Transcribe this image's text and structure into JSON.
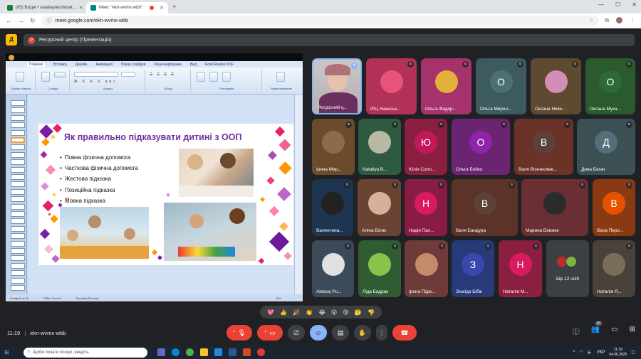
{
  "browser": {
    "tabs": [
      {
        "label": "(85) Вхідні • nataliayakuhonat...",
        "active": false,
        "fav_color": "#188038"
      },
      {
        "label": "Meet: \"ekn-wvmx-wbb\"",
        "active": true,
        "fav_color": "#00897b"
      }
    ],
    "url": "meet.google.com/ekn-wvmx-wbb"
  },
  "presentation_bar": {
    "label": "Ресурсний центр (Презентація)",
    "avatar_initial": "Р"
  },
  "ppt": {
    "tabs": [
      "Главная",
      "Вставка",
      "Дизайн",
      "Анимация",
      "Показ слайдов",
      "Рецензирование",
      "Вид",
      "Foxit Reader PDF"
    ],
    "ribbon_groups": [
      "Буфер обмена",
      "Слайды",
      "Шрифт",
      "Абзац",
      "Рисование",
      "Редактирование"
    ],
    "status": [
      "Слайд 6 из 28",
      "\"Office Theme\"",
      "Русский (Россия)",
      "40%"
    ],
    "slide": {
      "title": "Як правильно підказувати дитині з ООП",
      "bullets": [
        "Повна фізична допомога",
        "Часткова фізична допомога",
        "Жестова підказка",
        "Позиційна підказка",
        "Мовна підказка"
      ]
    }
  },
  "tiles": [
    {
      "name": "Ресурсний ц...",
      "type": "video",
      "color": "#c9c2c0"
    },
    {
      "name": "ІРЦ Уманськ...",
      "type": "pic",
      "color": "#b13157",
      "pic": "#e6547c"
    },
    {
      "name": "Ольга Федор...",
      "type": "pic",
      "color": "#a6326b",
      "pic": "#e3b03c"
    },
    {
      "name": "Ольга Мирон...",
      "type": "initial",
      "initial": "О",
      "color": "#3d5a5e",
      "circle": "#4e6f72"
    },
    {
      "name": "Оксана Ники...",
      "type": "pic",
      "color": "#5e4a30",
      "pic": "#d38db6"
    },
    {
      "name": "Оксана Муха...",
      "type": "initial",
      "initial": "О",
      "color": "#2b5a2f",
      "circle": "#2e6a33"
    },
    {
      "name": "Ірина Мир...",
      "type": "pic",
      "color": "#6a4c2c",
      "pic": "#8a6b4c"
    },
    {
      "name": "Nataliya B...",
      "type": "pic",
      "color": "#2e5a42",
      "pic": "#b7b9a3"
    },
    {
      "name": "Юлія Соло...",
      "type": "initial",
      "initial": "Ю",
      "color": "#8a1f3f",
      "circle": "#c2185b"
    },
    {
      "name": "Ольга Бойко",
      "type": "initial",
      "initial": "О",
      "color": "#6b2470",
      "circle": "#8e24aa"
    },
    {
      "name": "Валя Вознесиме...",
      "type": "initial",
      "initial": "В",
      "color": "#6b3228",
      "circle": "#5d4037"
    },
    {
      "name": "Дина Багач",
      "type": "initial",
      "initial": "Д",
      "color": "#3c5054",
      "circle": "#546e7a"
    },
    {
      "name": "Валентина...",
      "type": "pic",
      "color": "#1d3550",
      "pic": "#222"
    },
    {
      "name": "Аліна Білик",
      "type": "pic",
      "color": "#6b4332",
      "pic": "#d8b09a"
    },
    {
      "name": "Надія Пал...",
      "type": "initial",
      "initial": "Н",
      "color": "#891c45",
      "circle": "#d81b60"
    },
    {
      "name": "Валя Бандура",
      "type": "initial",
      "initial": "В",
      "color": "#5c3328",
      "circle": "#5d4037"
    },
    {
      "name": "Марина Бевзюк",
      "type": "pic",
      "color": "#6a2f32",
      "pic": "#2b2b2b"
    },
    {
      "name": "Вера Перо...",
      "type": "initial",
      "initial": "В",
      "color": "#8a3a12",
      "circle": "#e65100"
    },
    {
      "name": "Aleksej Pu...",
      "type": "pic",
      "color": "#3a4a58",
      "pic": "#e0e0e0"
    },
    {
      "name": "Ліда Бадрак",
      "type": "solid",
      "color": "#2f5c32",
      "circle": "#8bc34a"
    },
    {
      "name": "Ірина Підм...",
      "type": "pic",
      "color": "#6e3a3a",
      "pic": "#c58a6a"
    },
    {
      "name": "Зінаїда Бібік",
      "type": "initial",
      "initial": "З",
      "color": "#283a7a",
      "circle": "#3949ab"
    },
    {
      "name": "Наталія М...",
      "type": "initial",
      "initial": "Н",
      "color": "#8a1f3f",
      "circle": "#d81b60"
    },
    {
      "name": "Ще 12 осіб",
      "type": "more",
      "color": "#3c4043"
    },
    {
      "name": "Наталія Я...",
      "type": "pic",
      "color": "#48423a",
      "pic": "#7a6e5a"
    }
  ],
  "reactions": [
    "💖",
    "👍",
    "🎉",
    "👏",
    "😂",
    "😮",
    "😢",
    "🤔",
    "👎"
  ],
  "meeting": {
    "time": "11:19",
    "code": "ekn-wvmx-wbb",
    "people_count": "37"
  },
  "taskbar": {
    "search_placeholder": "Щоби почати пошук, введіть",
    "lang": "УКР",
    "clock_time": "11:19",
    "clock_date": "04.06.2025"
  }
}
